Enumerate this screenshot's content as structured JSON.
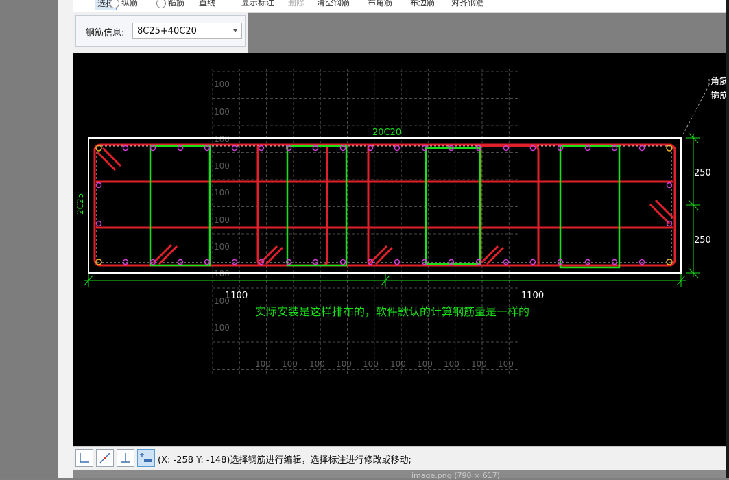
{
  "toolbar": {
    "items": [
      "选择",
      "纵筋",
      "箍筋",
      "直线",
      "显示标注",
      "删除",
      "清空钢筋",
      "布角筋",
      "布边筋",
      "对齐钢筋"
    ]
  },
  "rebar_info": {
    "label": "钢筋信息:",
    "value": "8C25+40C20"
  },
  "drawing": {
    "top_label": "20C20",
    "side_label": "2C25",
    "dim_bottom_left": "1100",
    "dim_bottom_right": "1100",
    "dim_right_top": "250",
    "dim_right_bottom": "250",
    "grid_labels_vertical": [
      "100",
      "100",
      "100",
      "100",
      "100",
      "100",
      "100",
      "100",
      "100",
      "100"
    ],
    "grid_labels_horizontal": [
      "100",
      "100",
      "100",
      "100",
      "100",
      "100",
      "100",
      "100",
      "100",
      "100"
    ],
    "annotation": "实际安装是这样排布的，软件默认的计算钢筋量是一样的",
    "callout_line1": "角筋",
    "callout_line2": "箍筋"
  },
  "status": {
    "coords": "(X: -258 Y: -148)",
    "message": "选择钢筋进行编辑，选择标注进行修改或移动;"
  },
  "caption": "image.png (790 × 617)",
  "colors": {
    "rebar": "#e0202a",
    "stirrup": "#19e019",
    "dimension": "#19e019",
    "section": "#ffffff",
    "grid": "#5a5a5a",
    "node": "#d040d8"
  }
}
